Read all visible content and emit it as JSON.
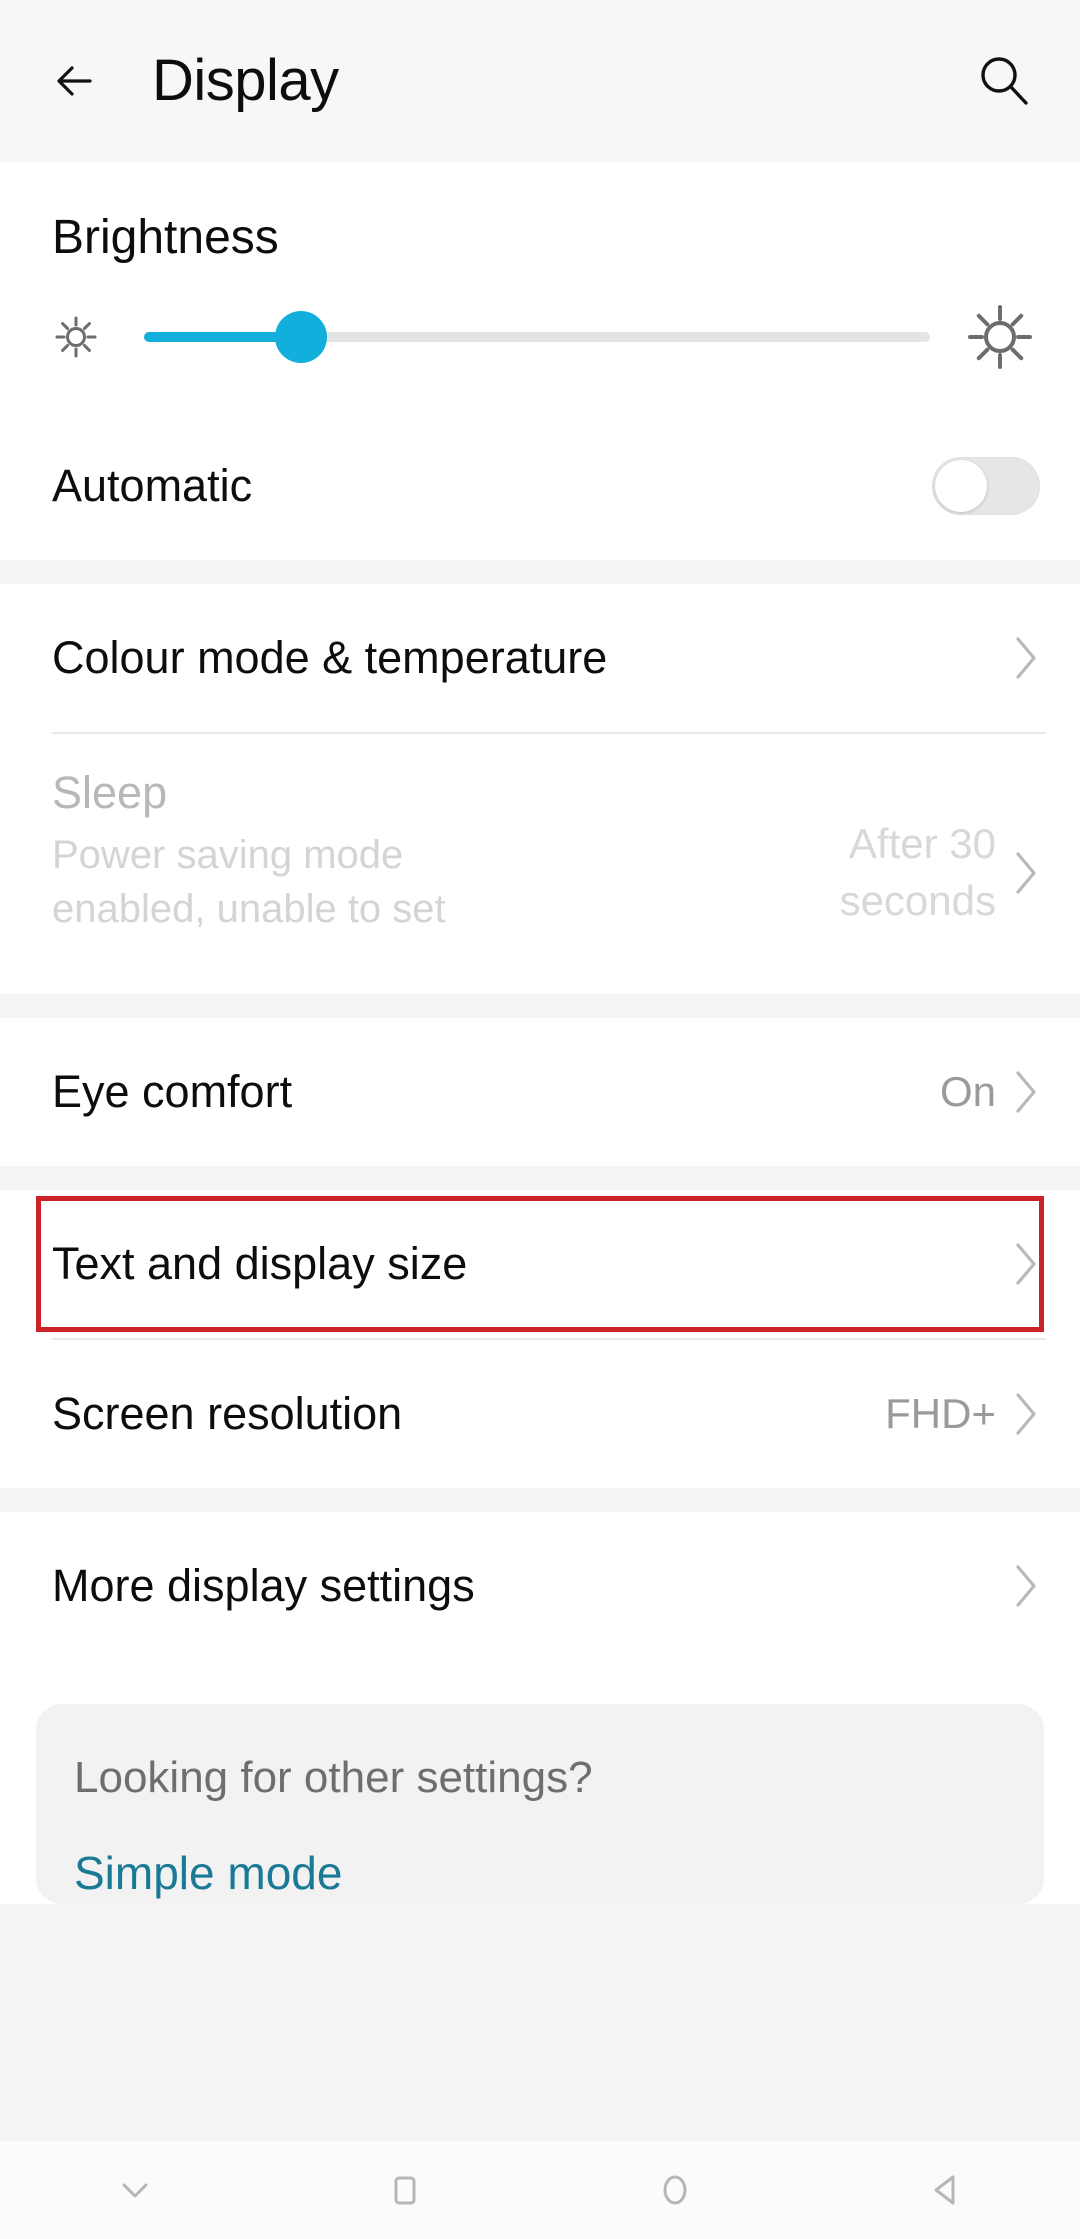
{
  "header": {
    "title": "Display",
    "back_icon": "back-arrow-icon",
    "search_icon": "search-icon"
  },
  "brightness": {
    "label": "Brightness",
    "low_icon": "sun-low-icon",
    "high_icon": "sun-high-icon",
    "slider_percent": 20,
    "accent_color": "#12afdc",
    "track_color": "#e4e4e4"
  },
  "automatic": {
    "label": "Automatic",
    "toggle_state": "off"
  },
  "colour_mode": {
    "label": "Colour mode & temperature",
    "chevron_icon": "chevron-right-icon"
  },
  "sleep": {
    "label": "Sleep",
    "subtitle": "Power saving mode enabled, unable to set",
    "value": "After 30 seconds",
    "disabled": true,
    "chevron_icon": "chevron-right-icon"
  },
  "eye_comfort": {
    "label": "Eye comfort",
    "value": "On",
    "chevron_icon": "chevron-right-icon"
  },
  "text_display_size": {
    "label": "Text and display size",
    "chevron_icon": "chevron-right-icon",
    "highlight_color": "#cc2229"
  },
  "screen_resolution": {
    "label": "Screen resolution",
    "value": "FHD+",
    "chevron_icon": "chevron-right-icon"
  },
  "more_display": {
    "label": "More display settings",
    "chevron_icon": "chevron-right-icon"
  },
  "footer_card": {
    "question": "Looking for other settings?",
    "link": "Simple mode",
    "link_color": "#1a7a96"
  },
  "navbar": {
    "buttons": [
      {
        "name": "chevron-down-icon",
        "label": ""
      },
      {
        "name": "recents-square-icon",
        "label": ""
      },
      {
        "name": "home-circle-icon",
        "label": ""
      },
      {
        "name": "back-triangle-icon",
        "label": ""
      }
    ]
  }
}
